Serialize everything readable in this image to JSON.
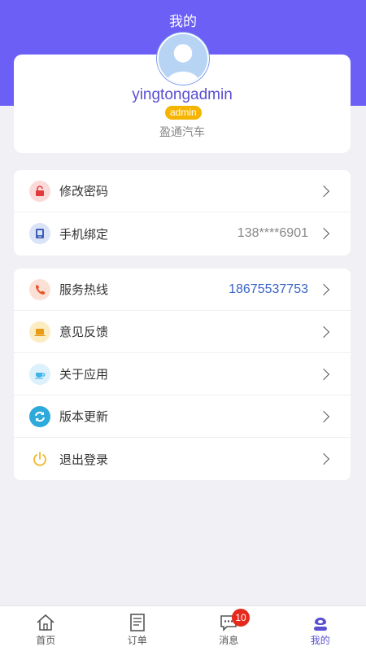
{
  "header": {
    "title": "我的"
  },
  "profile": {
    "username": "yingtongadmin",
    "role": "admin",
    "company": "盈通汽车"
  },
  "account_card": {
    "items": [
      {
        "label": "修改密码",
        "value": "",
        "icon": "lock-icon"
      },
      {
        "label": "手机绑定",
        "value": "138****6901",
        "icon": "phone-device-icon"
      }
    ]
  },
  "settings_card": {
    "items": [
      {
        "label": "服务热线",
        "value": "18675537753",
        "icon": "telephone-icon"
      },
      {
        "label": "意见反馈",
        "value": "",
        "icon": "laptop-icon"
      },
      {
        "label": "关于应用",
        "value": "",
        "icon": "cup-icon"
      },
      {
        "label": "版本更新",
        "value": "",
        "icon": "refresh-icon"
      },
      {
        "label": "退出登录",
        "value": "",
        "icon": "power-icon"
      }
    ]
  },
  "tabbar": {
    "tabs": [
      {
        "label": "首页",
        "icon": "home-icon"
      },
      {
        "label": "订单",
        "icon": "document-icon"
      },
      {
        "label": "消息",
        "icon": "message-icon",
        "badge": "10"
      },
      {
        "label": "我的",
        "icon": "user-icon",
        "active": true
      }
    ]
  },
  "colors": {
    "primary": "#6b5ff5",
    "username": "#5a4fd0",
    "badge": "#f5b400",
    "hotline": "#3a63c7",
    "notification": "#e6291c"
  }
}
